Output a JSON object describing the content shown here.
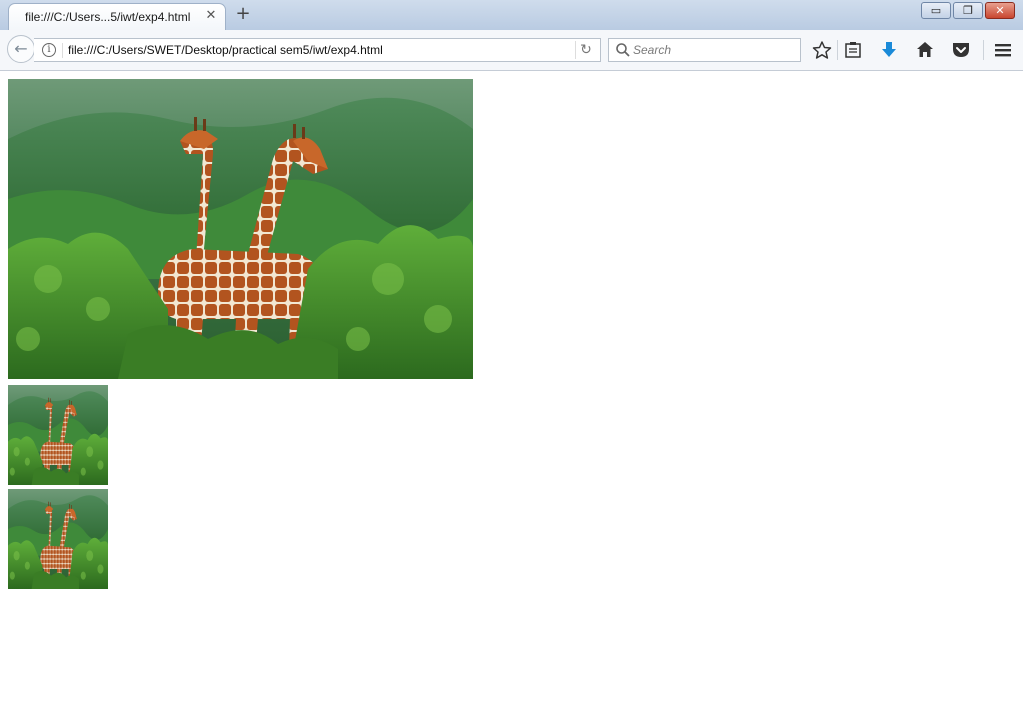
{
  "window": {
    "tab_title": "file:///C:/Users...5/iwt/exp4.html",
    "tab_close": "✕",
    "new_tab": "+",
    "minimize": "▭",
    "restore": "❐",
    "close": "✕"
  },
  "navbar": {
    "back": "←",
    "info": "i",
    "url": "file:///C:/Users/SWET/Desktop/practical sem5/iwt/exp4.html",
    "reload": "↻",
    "search_placeholder": "Search"
  },
  "toolbar_icons": [
    "bookmark-star-icon",
    "reading-list-icon",
    "download-icon",
    "home-icon",
    "pocket-icon",
    "menu-icon"
  ],
  "colors": {
    "download_accent": "#1a8ad8",
    "tab_bar": "#c3d4ea",
    "close_button": "#c9462f"
  },
  "images": [
    {
      "name": "giraffes-large-image"
    },
    {
      "name": "giraffes-thumbnail-1"
    },
    {
      "name": "giraffes-thumbnail-2"
    }
  ]
}
